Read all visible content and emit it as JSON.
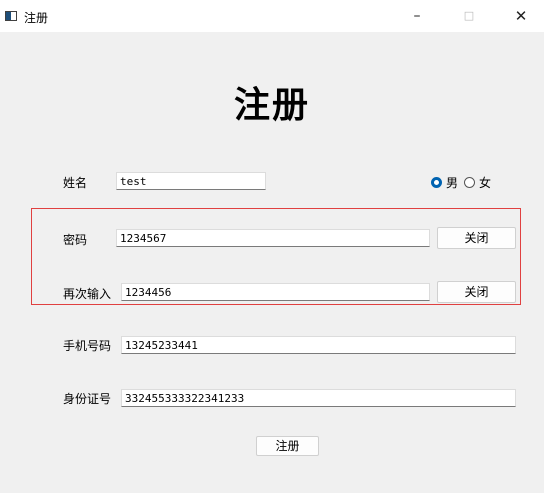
{
  "window": {
    "title": "注册",
    "minimize": "–",
    "maximize": "□",
    "close": "✕"
  },
  "heading": "注册",
  "fields": {
    "name": {
      "label": "姓名",
      "value": "test"
    },
    "password": {
      "label": "密码",
      "value": "1234567",
      "button": "关闭"
    },
    "confirm": {
      "label": "再次输入",
      "value": "1234456",
      "button": "关闭"
    },
    "phone": {
      "label": "手机号码",
      "value": "13245233441"
    },
    "idcard": {
      "label": "身份证号",
      "value": "332455333322341233"
    }
  },
  "gender": {
    "options": [
      "男",
      "女"
    ],
    "selected": "男"
  },
  "submit_label": "注册",
  "colors": {
    "accent": "#0063b1",
    "highlight_border": "#e04040"
  }
}
